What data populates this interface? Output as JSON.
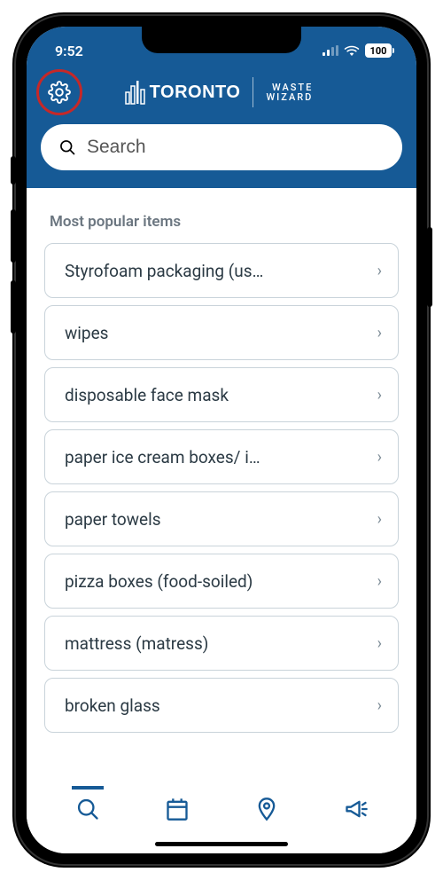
{
  "status": {
    "time": "9:52",
    "battery": "100"
  },
  "header": {
    "brand_city": "Toronto",
    "brand_app_line1": "WASTE",
    "brand_app_line2": "WIZARD"
  },
  "search": {
    "placeholder": "Search"
  },
  "section": {
    "title": "Most popular items"
  },
  "items": [
    {
      "label": "Styrofoam packaging (us…"
    },
    {
      "label": "wipes"
    },
    {
      "label": "disposable face mask"
    },
    {
      "label": "paper ice cream boxes/ i…"
    },
    {
      "label": "paper towels"
    },
    {
      "label": "pizza boxes (food-soiled)"
    },
    {
      "label": "mattress (matress)"
    },
    {
      "label": "broken glass"
    }
  ],
  "nav": {
    "active_index": 0,
    "tabs": [
      "search",
      "schedule",
      "locations",
      "announcements"
    ]
  }
}
